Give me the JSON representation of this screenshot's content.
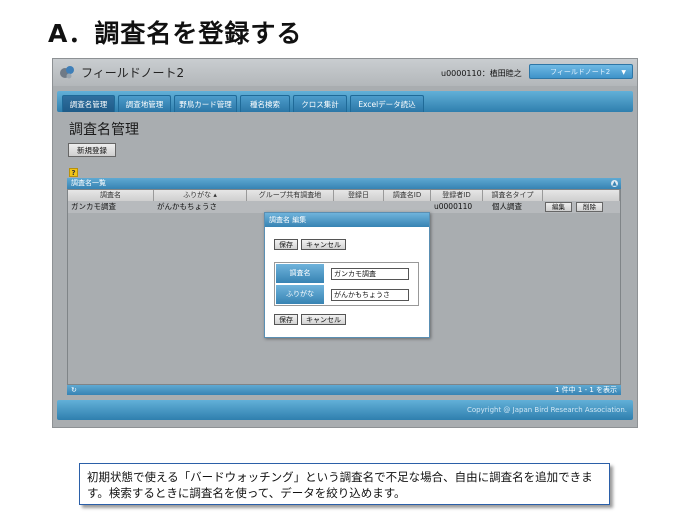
{
  "slide": {
    "title": "A．調査名を登録する",
    "note": "初期状態で使える「バードウォッチング」という調査名で不足な場合、自由に調査名を追加できます。検索するときに調査名を使って、データを絞り込めます。"
  },
  "app": {
    "title": "フィールドノート2",
    "user": "u0000110：植田睦之",
    "project_select": "フィールドノート2"
  },
  "nav": {
    "tabs": [
      {
        "label": "調査名管理"
      },
      {
        "label": "調査地管理"
      },
      {
        "label": "野鳥カード管理"
      },
      {
        "label": "種名検索"
      },
      {
        "label": "クロス集計"
      },
      {
        "label": "Excelデータ読込"
      }
    ]
  },
  "page": {
    "title": "調査名管理",
    "new_button": "新規登録",
    "help": "?"
  },
  "list": {
    "header": "調査名一覧",
    "columns": [
      "調査名",
      "ふりがな ▴",
      "グループ共有調査地",
      "登録日",
      "調査名ID",
      "登録者ID",
      "調査名タイプ"
    ],
    "rows": [
      {
        "name": "ガンカモ調査",
        "furigana": "がんかもちょうさ",
        "group_shared": "",
        "date": "",
        "survey_id": "",
        "registrant_id": "u0000110",
        "type": "個人調査",
        "edit_label": "編集",
        "delete_label": "削除"
      }
    ],
    "pager": "1 件中 1 - 1 を表示"
  },
  "dialog": {
    "title": "調査名 編集",
    "save_label": "保存",
    "cancel_label": "キャンセル",
    "fields": {
      "name_label": "調査名",
      "name_value": "ガンカモ調査",
      "furigana_label": "ふりがな",
      "furigana_value": "がんかもちょうさ"
    }
  },
  "footer": {
    "copyright": "Copyright @ Japan Bird Research Association."
  }
}
